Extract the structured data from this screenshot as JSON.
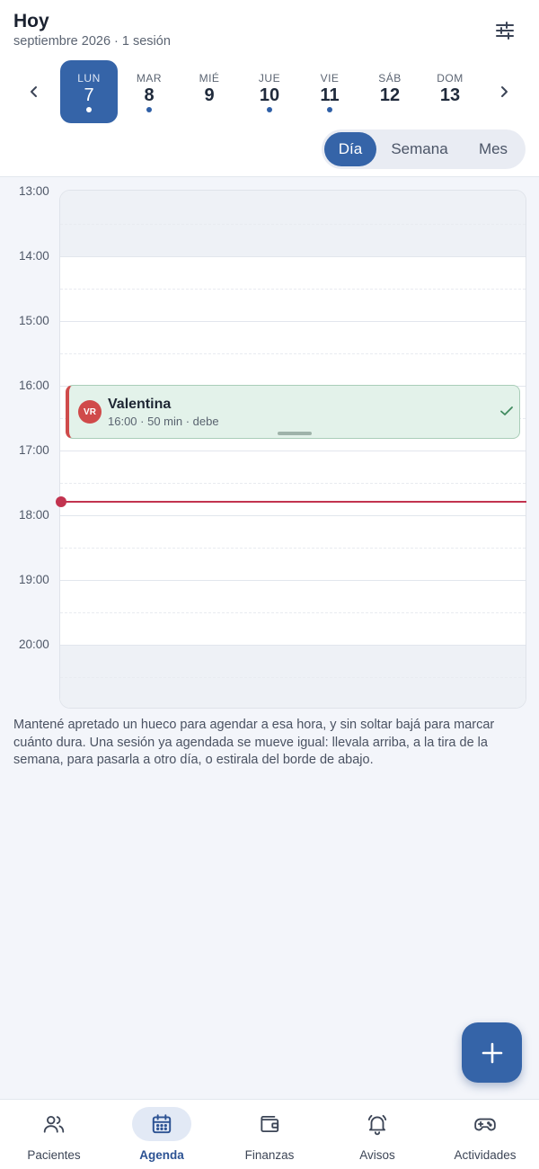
{
  "header": {
    "title": "Hoy",
    "subtitle": "septiembre 2026 · 1 sesión"
  },
  "week": {
    "days": [
      {
        "dow": "LUN",
        "num": "7",
        "dot": true,
        "active": true
      },
      {
        "dow": "MAR",
        "num": "8",
        "dot": true,
        "active": false
      },
      {
        "dow": "MIÉ",
        "num": "9",
        "dot": false,
        "active": false
      },
      {
        "dow": "JUE",
        "num": "10",
        "dot": true,
        "active": false
      },
      {
        "dow": "VIE",
        "num": "11",
        "dot": true,
        "active": false
      },
      {
        "dow": "SÁB",
        "num": "12",
        "dot": false,
        "active": false
      },
      {
        "dow": "DOM",
        "num": "13",
        "dot": false,
        "active": false
      }
    ]
  },
  "view_switch": {
    "options": [
      "Día",
      "Semana",
      "Mes"
    ],
    "selected": "Día"
  },
  "timeline": {
    "hours": [
      "13:00",
      "14:00",
      "15:00",
      "16:00",
      "17:00",
      "18:00",
      "19:00",
      "20:00"
    ],
    "current_time": "17:48"
  },
  "event": {
    "initials": "VR",
    "name": "Valentina",
    "meta": "16:00 · 50 min · debe",
    "accent": "#cf4b4b",
    "status_icon": "check-icon"
  },
  "help_text": "Mantené apretado un hueco para agendar a esa hora, y sin soltar bajá para marcar cuánto dura. Una sesión ya agendada se mueve igual: llevala arriba, a la tira de la semana, para pasarla a otro día, o estirala del borde de abajo.",
  "fab": {
    "icon": "plus-icon"
  },
  "bottom_nav": {
    "items": [
      {
        "label": "Pacientes",
        "icon": "users-icon",
        "active": false
      },
      {
        "label": "Agenda",
        "icon": "calendar-icon",
        "active": true
      },
      {
        "label": "Finanzas",
        "icon": "wallet-icon",
        "active": false
      },
      {
        "label": "Avisos",
        "icon": "bell-icon",
        "active": false
      },
      {
        "label": "Actividades",
        "icon": "gamepad-icon",
        "active": false
      }
    ]
  },
  "colors": {
    "primary": "#3564a8",
    "now_line": "#c2334f",
    "event_bg": "#e3f2ea"
  }
}
